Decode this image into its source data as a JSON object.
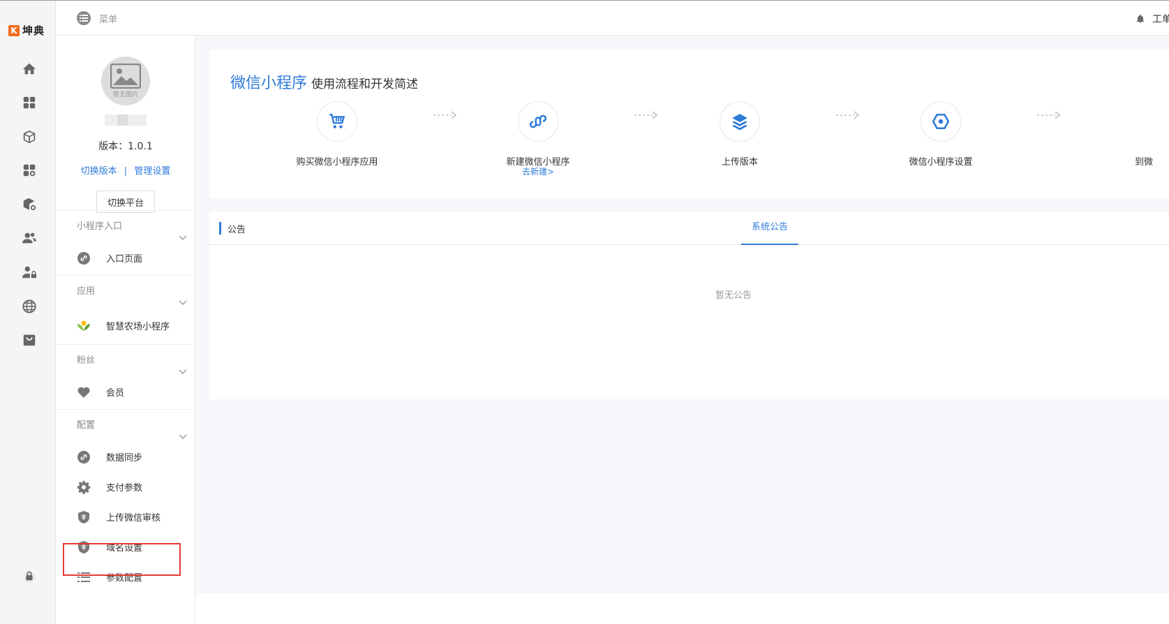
{
  "brand": {
    "logo_mark": "K",
    "name": "坤典"
  },
  "rail": {
    "icons": [
      "home-icon",
      "apps-grid-icon",
      "cube-icon",
      "apps-settings-icon",
      "cube-settings-icon",
      "users-icon",
      "user-lock-icon",
      "globe-icon",
      "shop-bag-icon",
      "lock-icon"
    ]
  },
  "header": {
    "menu_label": "菜单",
    "right_label": "工单"
  },
  "sidebar": {
    "avatar_placeholder": "暂无图片",
    "version": "版本：1.0.1",
    "link_switch_version": "切换版本",
    "link_separator": "|",
    "link_manage": "管理设置",
    "switch_platform": "切换平台",
    "groups": [
      {
        "title": "小程序入口",
        "items": [
          {
            "label": "入口页面",
            "icon": "link-icon"
          }
        ]
      },
      {
        "title": "应用",
        "items": [
          {
            "label": "智慧农场小程序",
            "icon": "farm-app-icon"
          }
        ]
      },
      {
        "title": "粉丝",
        "items": [
          {
            "label": "会员",
            "icon": "heart-icon"
          }
        ]
      },
      {
        "title": "配置",
        "items": [
          {
            "label": "数据同步",
            "icon": "link-icon"
          },
          {
            "label": "支付参数",
            "icon": "gear-icon"
          },
          {
            "label": "上传微信审核",
            "icon": "shield-icon",
            "highlighted": true
          },
          {
            "label": "域名设置",
            "icon": "shield-icon"
          },
          {
            "label": "参数配置",
            "icon": "list-icon"
          }
        ]
      }
    ]
  },
  "flow": {
    "title_accent": "微信小程序",
    "title_rest": "使用流程和开发简述",
    "steps": [
      {
        "label": "购买微信小程序应用",
        "icon": "cart-icon"
      },
      {
        "label": "新建微信小程序",
        "sub": "去新建>",
        "icon": "mini-program-icon"
      },
      {
        "label": "上传版本",
        "icon": "layers-icon"
      },
      {
        "label": "微信小程序设置",
        "icon": "hexagon-settings-icon"
      },
      {
        "label": "到微"
      }
    ]
  },
  "notice": {
    "title": "公告",
    "tab": "系统公告",
    "empty": "暂无公告"
  },
  "colors": {
    "accent": "#2f7bd8",
    "brand": "#f26b1d",
    "highlight_border": "#e53935"
  }
}
